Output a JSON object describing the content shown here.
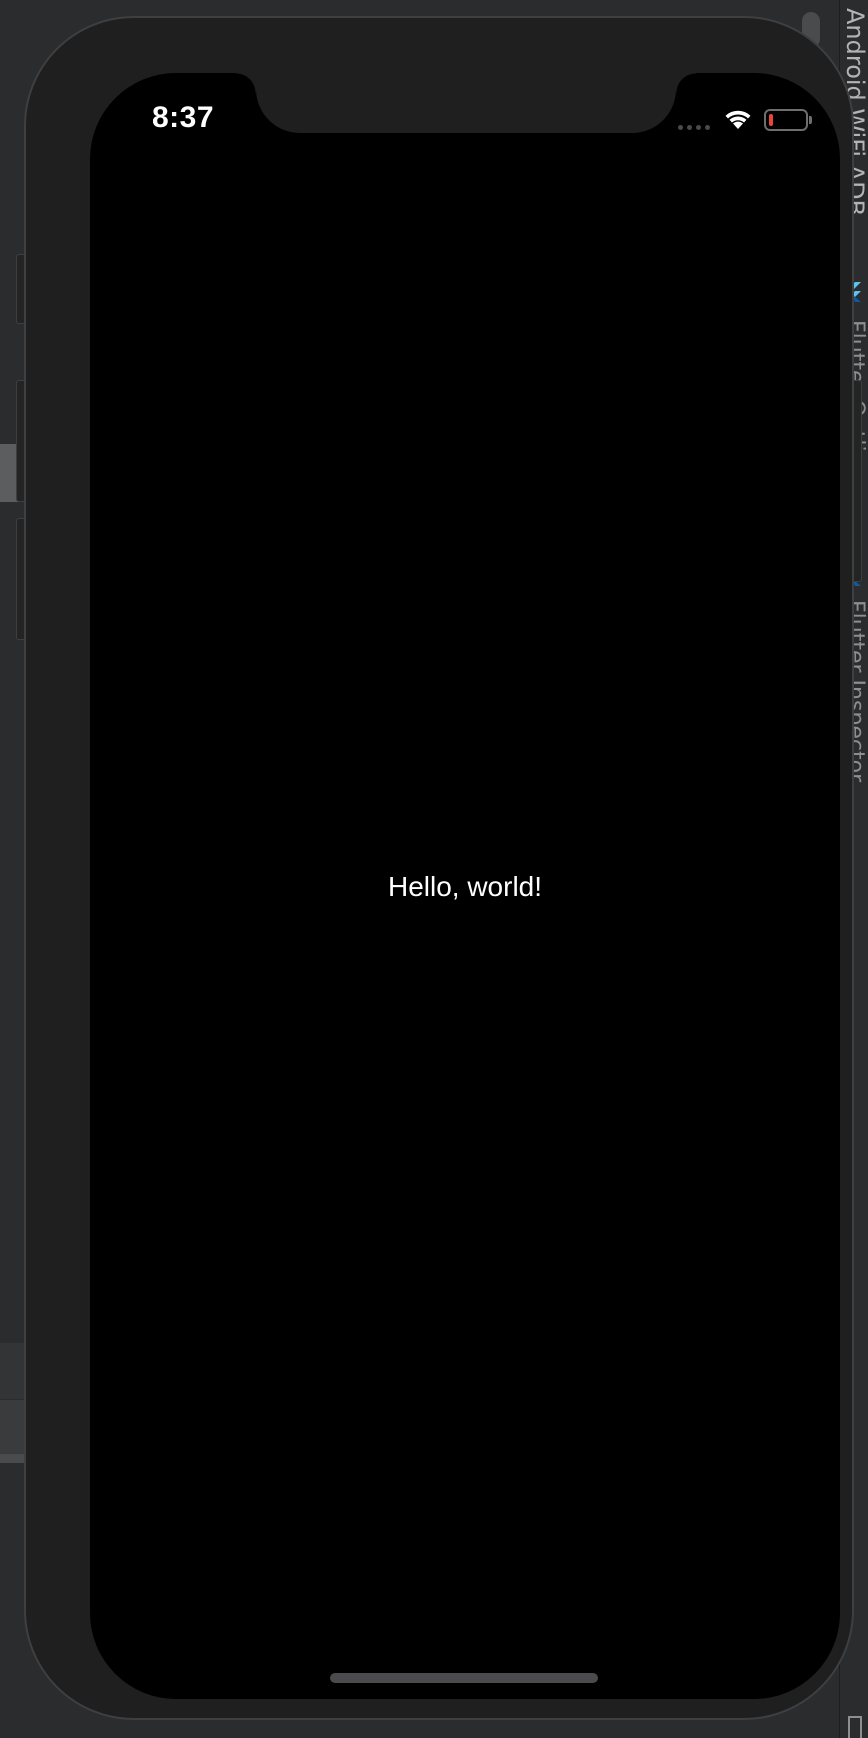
{
  "ide": {
    "side_tabs": [
      "Android WiFi ADB",
      "Flutter Outline",
      "Flutter Inspector"
    ]
  },
  "status_bar": {
    "time": "8:37",
    "signal_icon": "cellular-dots-icon",
    "wifi_icon": "wifi-icon",
    "battery_icon": "battery-low-icon",
    "battery_level": 0.1,
    "battery_color": "#e8453c"
  },
  "app": {
    "body_text": "Hello, world!",
    "background": "#000000",
    "text_color": "#ffffff"
  }
}
